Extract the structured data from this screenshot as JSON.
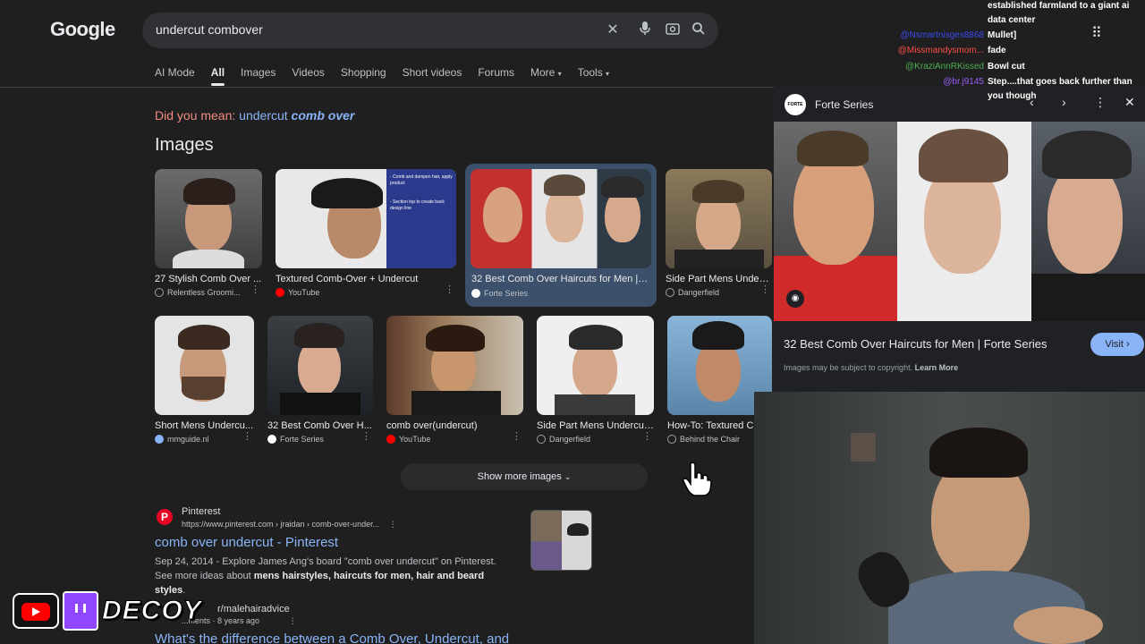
{
  "header": {
    "logo_text": "Google",
    "search_query": "undercut combover",
    "icons": [
      "close-icon",
      "mic-icon",
      "lens-icon",
      "search-icon"
    ]
  },
  "tabs": [
    {
      "label": "AI Mode"
    },
    {
      "label": "All"
    },
    {
      "label": "Images"
    },
    {
      "label": "Videos"
    },
    {
      "label": "Shopping"
    },
    {
      "label": "Short videos"
    },
    {
      "label": "Forums"
    },
    {
      "label": "More"
    },
    {
      "label": "Tools"
    }
  ],
  "did_you_mean": {
    "prefix": "Did you mean:",
    "normal": "undercut",
    "bold": "comb over"
  },
  "images_heading": "Images",
  "image_results": [
    {
      "title": "27 Stylish Comb Over ...",
      "source": "Relentless Groomi...",
      "src_color": "#9aa0a6"
    },
    {
      "title": "Textured Comb-Over + Undercut",
      "source": "YouTube",
      "src_color": "#ff0000"
    },
    {
      "title": "32 Best Comb Over Haircuts for Men | F...",
      "source": "Forte Series",
      "src_color": "#ffffff"
    },
    {
      "title": "Side Part Mens Underc...",
      "source": "Dangerfield",
      "src_color": "#9aa0a6"
    },
    {
      "title": "Short Mens Undercu...",
      "source": "mmguide.nl",
      "src_color": "#8ab4f8"
    },
    {
      "title": "32 Best Comb Over H...",
      "source": "Forte Series",
      "src_color": "#ffffff"
    },
    {
      "title": "comb over(undercut)",
      "source": "YouTube",
      "src_color": "#ff0000"
    },
    {
      "title": "Side Part Mens Undercut...",
      "source": "Dangerfield",
      "src_color": "#9aa0a6"
    },
    {
      "title": "How-To: Textured C...",
      "source": "Behind the Chair",
      "src_color": "#9aa0a6"
    }
  ],
  "image_overlay_text": [
    "- Comb and dampen hair, apply product",
    "- Section top to create back design line"
  ],
  "show_more": "Show more images",
  "result1": {
    "site": "Pinterest",
    "url": "https://www.pinterest.com › jraidan › comb-over-under...",
    "title": "comb over undercut - Pinterest",
    "snippet_pre": "Sep 24, 2014 - Explore James Ang's board \"comb over undercut\" on Pinterest. See more ideas about ",
    "snippet_bold": "mens hairstyles, haircuts for men, hair and beard styles",
    "snippet_post": "."
  },
  "result2": {
    "site": "r/malehairadvice",
    "meta": "...ments · 8 years ago",
    "title": "What's the difference between a Comb Over, Undercut, and"
  },
  "stream": {
    "brand": "DECOY"
  },
  "panel": {
    "source": "Forte Series",
    "logo_text": "FORTE",
    "title": "32 Best Comb Over Haircuts for Men | Forte Series",
    "visit": "Visit",
    "copyright_pre": "Images may be subject to copyright.",
    "copyright_link": "Learn More"
  },
  "chat": [
    {
      "name": "",
      "msg": "established farmland to a giant ai",
      "name_color": ""
    },
    {
      "name": "",
      "msg": "data center",
      "name_color": ""
    },
    {
      "name": "@Nsmartnisges8868",
      "msg": "Mullet]",
      "name_color": "#3b4cf5"
    },
    {
      "name": "@Missmandysmom...",
      "msg": "fade",
      "name_color": "#ff4d4d"
    },
    {
      "name": "@KraziAnnRKissed",
      "msg": "Bowl cut",
      "name_color": "#4caf50"
    },
    {
      "name": "@br.j9145",
      "msg": "Step....that goes back further than",
      "name_color": "#9b5cff"
    },
    {
      "name": "",
      "msg": "you though",
      "name_color": ""
    }
  ],
  "colors": {
    "background": "#1f1f1f",
    "link": "#8ab4f8",
    "suggest": "#f28b82"
  }
}
